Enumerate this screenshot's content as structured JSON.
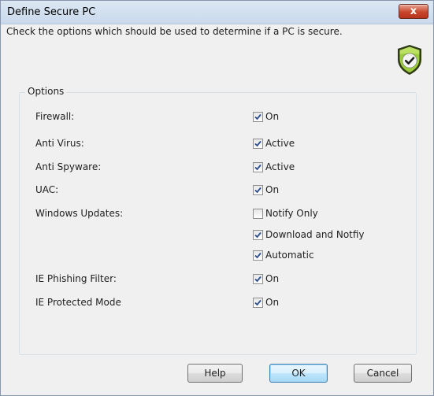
{
  "window": {
    "title": "Define Secure PC",
    "close_label": "x"
  },
  "instruction": "Check the options which should be used to determine if a PC is secure.",
  "options_group": {
    "label": "Options",
    "rows": [
      {
        "label": "Firewall:",
        "checks": [
          {
            "label": "On",
            "checked": true
          }
        ]
      },
      {
        "label": "Anti Virus:",
        "checks": [
          {
            "label": "Active",
            "checked": true
          }
        ]
      },
      {
        "label": "Anti Spyware:",
        "checks": [
          {
            "label": "Active",
            "checked": true
          }
        ]
      },
      {
        "label": "UAC:",
        "checks": [
          {
            "label": "On",
            "checked": true
          }
        ]
      },
      {
        "label": "Windows Updates:",
        "checks": [
          {
            "label": "Notify Only",
            "checked": false
          },
          {
            "label": "Download and Notfiy",
            "checked": true
          },
          {
            "label": "Automatic",
            "checked": true
          }
        ]
      },
      {
        "label": "IE Phishing Filter:",
        "checks": [
          {
            "label": "On",
            "checked": true
          }
        ]
      },
      {
        "label": "IE Protected Mode",
        "checks": [
          {
            "label": "On",
            "checked": true
          }
        ]
      }
    ]
  },
  "buttons": {
    "help": "Help",
    "ok": "OK",
    "cancel": "Cancel"
  },
  "icons": {
    "shield": "shield-check-icon",
    "check": "checkmark-icon",
    "close": "close-icon"
  },
  "colors": {
    "shield_fill": "#8cc63f",
    "check_color": "#2a4d8f"
  }
}
